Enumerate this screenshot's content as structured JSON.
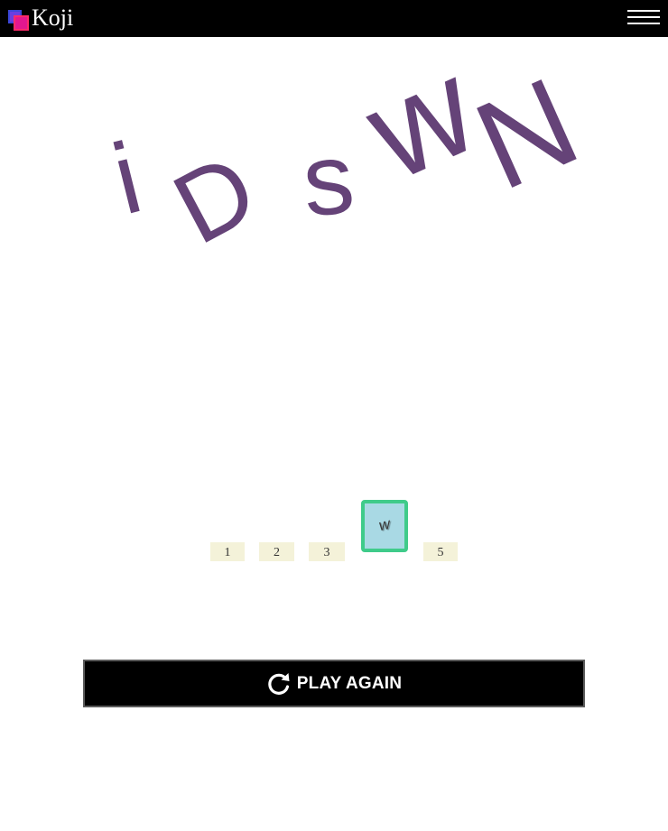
{
  "header": {
    "brand": "Koji",
    "logo_icon": "koji-logo-icon",
    "menu_icon": "hamburger-menu-icon"
  },
  "puzzle": {
    "letters": [
      "i",
      "D",
      "s",
      "w",
      "N"
    ],
    "letter_color": "#654378"
  },
  "answer_slots": [
    {
      "label": "1",
      "filled": false
    },
    {
      "label": "2",
      "filled": false
    },
    {
      "label": "3",
      "filled": false
    },
    {
      "label": "",
      "filled": true,
      "tile": "w"
    },
    {
      "label": "5",
      "filled": false
    }
  ],
  "actions": {
    "play_again_label": "PLAY AGAIN",
    "play_again_icon": "refresh-icon"
  },
  "colors": {
    "topbar": "#000000",
    "tile_border": "#3fcb8a",
    "tile_fill": "#a9d9e4",
    "slot_fill": "#f4f2d9"
  }
}
